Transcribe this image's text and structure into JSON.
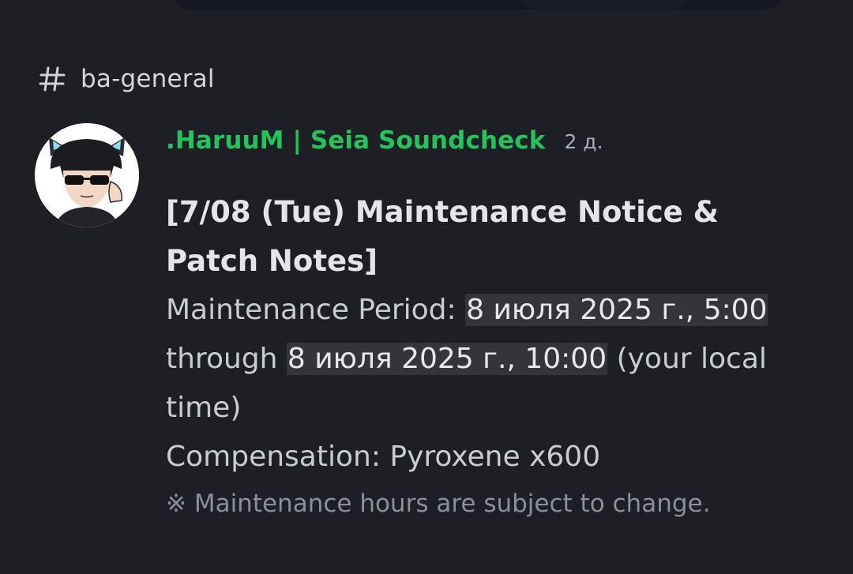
{
  "channel": {
    "icon": "hash-icon",
    "name": "ba-general"
  },
  "message": {
    "author": ".HaruuM | Seia Soundcheck",
    "author_color": "#23c45e",
    "timestamp": "2 д.",
    "title": "[7/08 (Tue) Maintenance Notice & Patch Notes]",
    "maintenance_label": "Maintenance Period: ",
    "start_time": "8 июля 2025 г., 5:00",
    "through": " through ",
    "end_time": "8 июля 2025 г., 10:00",
    "local_time_suffix": " (your local time)",
    "compensation": "Compensation: Pyroxene x600",
    "note": "※ Maintenance hours are subject to change."
  }
}
